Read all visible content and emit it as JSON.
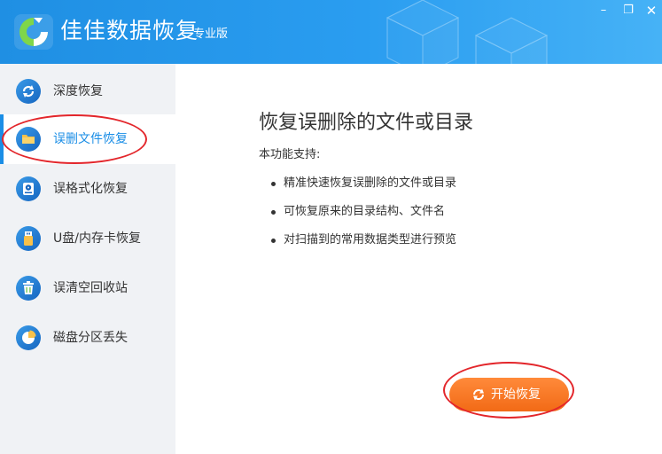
{
  "titlebar": {
    "app_title": "佳佳数据恢复",
    "edition": "专业版",
    "minimize_glyph": "–",
    "restore_glyph": "❐",
    "close_glyph": "✕",
    "brand_color": "#2a9df0"
  },
  "sidebar": {
    "items": [
      {
        "label": "深度恢复",
        "icon": "refresh-icon",
        "active": false
      },
      {
        "label": "误删文件恢复",
        "icon": "folder-icon",
        "active": true
      },
      {
        "label": "误格式化恢复",
        "icon": "hard-disk-icon",
        "active": false
      },
      {
        "label": "U盘/内存卡恢复",
        "icon": "usb-drive-icon",
        "active": false
      },
      {
        "label": "误清空回收站",
        "icon": "recycle-bin-icon",
        "active": false
      },
      {
        "label": "磁盘分区丢失",
        "icon": "pie-chart-icon",
        "active": false
      }
    ],
    "active_color": "#1b8ee6"
  },
  "main": {
    "heading": "恢复误删除的文件或目录",
    "support_label": "本功能支持:",
    "features": [
      "精准快速恢复误删除的文件或目录",
      "可恢复原来的目录结构、文件名",
      "对扫描到的常用数据类型进行预览"
    ],
    "start_button_label": "开始恢复",
    "start_button_color": "#f26a16"
  },
  "annotations": {
    "highlight_color": "#e3262b"
  }
}
